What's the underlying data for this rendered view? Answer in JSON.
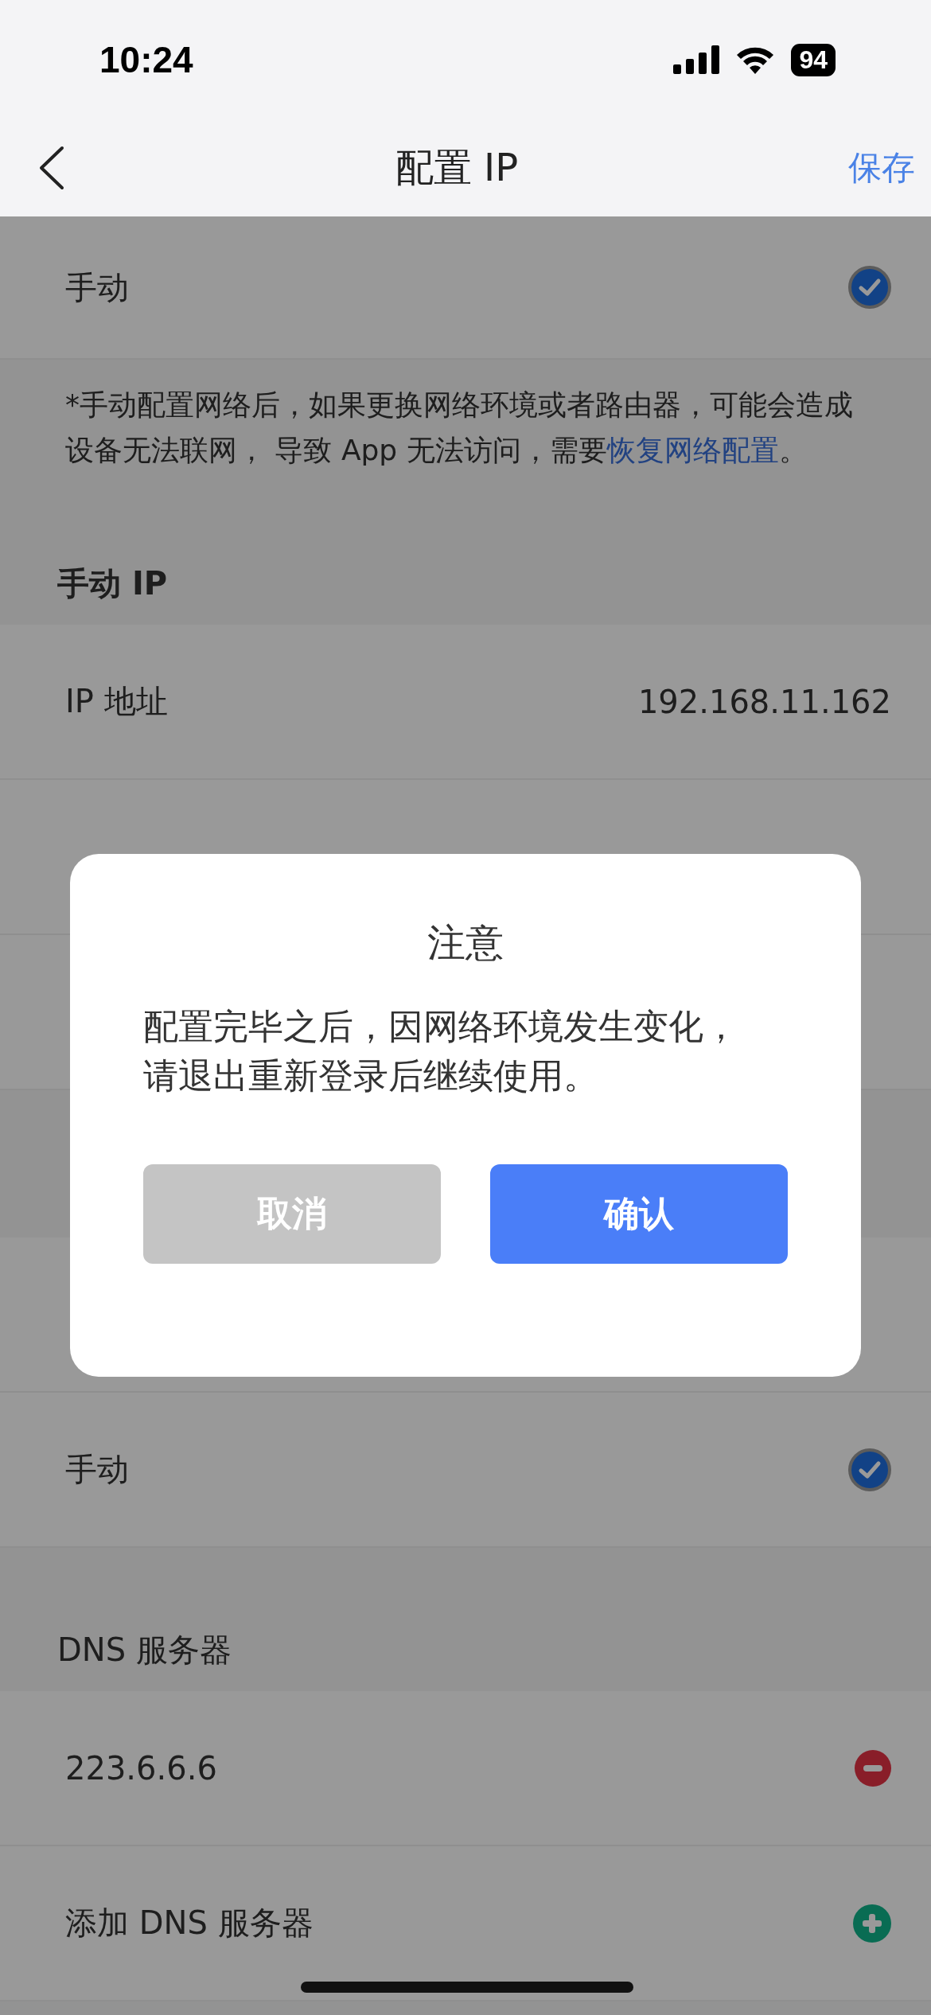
{
  "status_bar": {
    "time": "10:24",
    "battery": "94"
  },
  "nav": {
    "title": "配置 IP",
    "action": "保存"
  },
  "mode_option": {
    "label": "手动",
    "checked": true
  },
  "notice": {
    "text": "*手动配置网络后，如果更换网络环境或者路由器，可能会造成设备无法联网， 导致 App 无法访问，需要",
    "link": "恢复网络配置",
    "end": "。"
  },
  "manual_ip": {
    "header": "手动 IP",
    "rows": [
      {
        "label": "IP 地址",
        "value": "192.168.11.162"
      }
    ]
  },
  "dns_mode": {
    "label": "手动",
    "checked": true
  },
  "dns": {
    "header": "DNS 服务器",
    "items": [
      {
        "kind": "remove",
        "text": "223.6.6.6"
      },
      {
        "kind": "add",
        "text": "添加 DNS 服务器"
      }
    ]
  },
  "dialog": {
    "title": "注意",
    "message": "配置完毕之后，因网络环境发生变化，请退出重新登录后继续使用。",
    "buttons": [
      {
        "label": "取消",
        "kind": "cancel"
      },
      {
        "label": "确认",
        "kind": "confirm"
      }
    ]
  }
}
